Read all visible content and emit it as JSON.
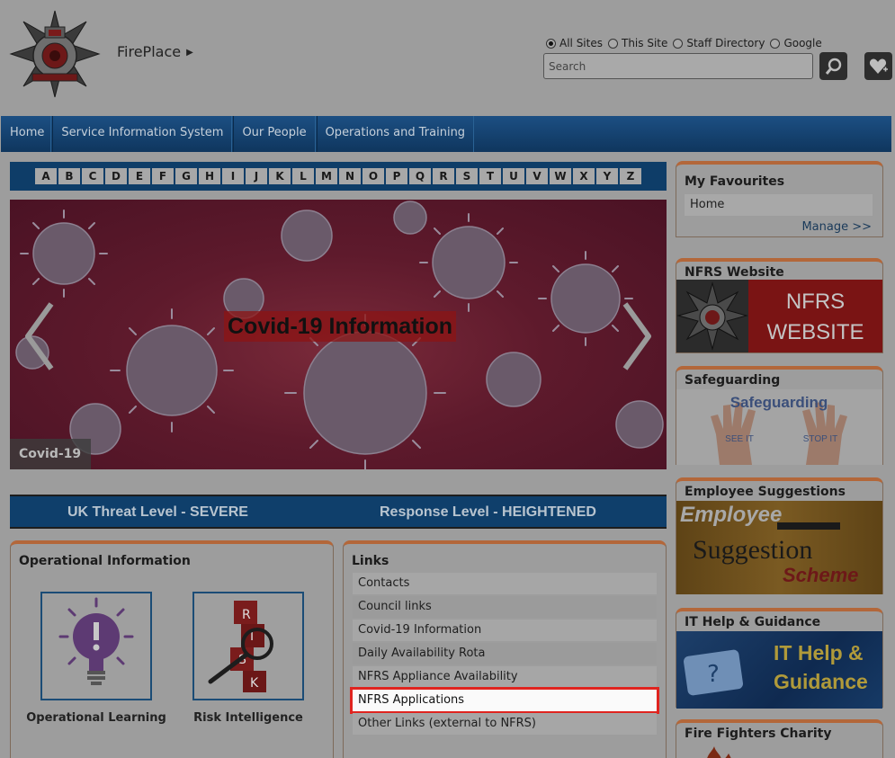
{
  "header": {
    "site_title": "FirePlace",
    "search_scopes": [
      {
        "label": "All Sites",
        "selected": true
      },
      {
        "label": "This Site",
        "selected": false
      },
      {
        "label": "Staff Directory",
        "selected": false
      },
      {
        "label": "Google",
        "selected": false
      }
    ],
    "search_placeholder": "Search",
    "search_icon": "magnifier-icon",
    "favourite_icon": "heart-plus-icon"
  },
  "nav": {
    "items": [
      "Home",
      "Service Information System",
      "Our People",
      "Operations and Training"
    ]
  },
  "az": [
    "A",
    "B",
    "C",
    "D",
    "E",
    "F",
    "G",
    "H",
    "I",
    "J",
    "K",
    "L",
    "M",
    "N",
    "O",
    "P",
    "Q",
    "R",
    "S",
    "T",
    "U",
    "V",
    "W",
    "X",
    "Y",
    "Z"
  ],
  "carousel": {
    "slide_title": "Covid-19 Information",
    "caption": "Covid-19"
  },
  "threat": {
    "uk_level": "UK Threat Level - SEVERE",
    "response_level": "Response Level - HEIGHTENED"
  },
  "operational": {
    "title": "Operational Information",
    "tiles": [
      {
        "label": "Operational Learning"
      },
      {
        "label": "Risk Intelligence"
      }
    ]
  },
  "links": {
    "title": "Links",
    "items": [
      "Contacts",
      "Council links",
      "Covid-19 Information",
      "Daily Availability Rota",
      "NFRS Appliance Availability",
      "NFRS Applications",
      "Other Links (external to NFRS)"
    ],
    "selected_index": 5
  },
  "favourites": {
    "title": "My Favourites",
    "items": [
      "Home"
    ],
    "manage": "Manage >>"
  },
  "sidebar": {
    "nfrs_website": {
      "title": "NFRS Website",
      "banner_line1": "NFRS",
      "banner_line2": "WEBSITE"
    },
    "safeguarding": {
      "title": "Safeguarding",
      "banner": "Safeguarding",
      "hand_left": "SEE IT",
      "hand_right": "STOP IT"
    },
    "employee": {
      "title": "Employee Suggestions",
      "line1": "Employee",
      "line2": "Suggestion",
      "line3": "Scheme"
    },
    "it_help": {
      "title": "IT Help & Guidance",
      "line1": "IT Help &",
      "line2": "Guidance"
    },
    "charity": {
      "title": "Fire Fighters Charity"
    }
  },
  "colors": {
    "accent_orange": "#b3673a",
    "nav_blue": "#0f365e",
    "highlight_red": "#e0241f"
  }
}
